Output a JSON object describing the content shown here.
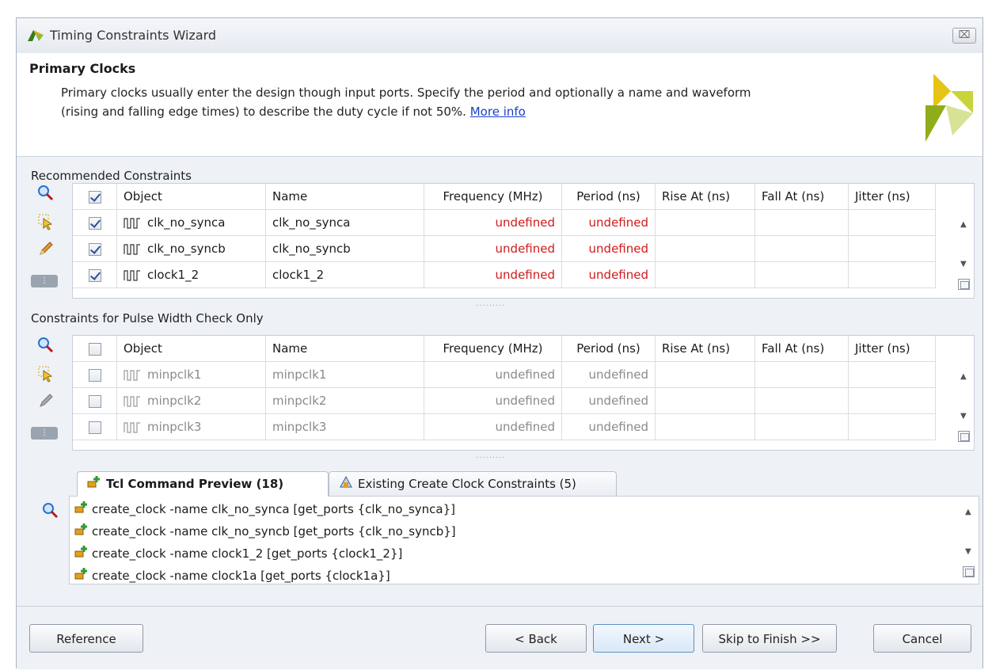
{
  "window": {
    "title": "Timing Constraints Wizard",
    "close_label": "⌧"
  },
  "header": {
    "title": "Primary Clocks",
    "description_line1": "Primary clocks usually enter the design though input ports. Specify the period and optionally a name and waveform",
    "description_line2": "(rising and falling edge times) to describe the duty cycle if not 50%.",
    "more_info": "More info"
  },
  "recommended": {
    "label": "Recommended Constraints",
    "columns": [
      "Object",
      "Name",
      "Frequency (MHz)",
      "Period (ns)",
      "Rise At (ns)",
      "Fall At (ns)",
      "Jitter (ns)"
    ],
    "rows": [
      {
        "object": "clk_no_synca",
        "name": "clk_no_synca",
        "frequency": "undefined",
        "period": "undefined",
        "checked": true
      },
      {
        "object": "clk_no_syncb",
        "name": "clk_no_syncb",
        "frequency": "undefined",
        "period": "undefined",
        "checked": true
      },
      {
        "object": "clock1_2",
        "name": "clock1_2",
        "frequency": "undefined",
        "period": "undefined",
        "checked": true
      }
    ]
  },
  "pulse": {
    "label": "Constraints for Pulse Width Check Only",
    "columns": [
      "Object",
      "Name",
      "Frequency (MHz)",
      "Period (ns)",
      "Rise At (ns)",
      "Fall At (ns)",
      "Jitter (ns)"
    ],
    "rows": [
      {
        "object": "minpclk1",
        "name": "minpclk1",
        "frequency": "undefined",
        "period": "undefined",
        "checked": false
      },
      {
        "object": "minpclk2",
        "name": "minpclk2",
        "frequency": "undefined",
        "period": "undefined",
        "checked": false
      },
      {
        "object": "minpclk3",
        "name": "minpclk3",
        "frequency": "undefined",
        "period": "undefined",
        "checked": false
      }
    ]
  },
  "splitter": "·········",
  "tabs": [
    {
      "label": "Tcl Command Preview (18)",
      "active": true
    },
    {
      "label": "Existing Create Clock Constraints (5)",
      "active": false
    }
  ],
  "tcl": [
    "create_clock -name clk_no_synca [get_ports {clk_no_synca}]",
    "create_clock -name clk_no_syncb [get_ports {clk_no_syncb}]",
    "create_clock -name clock1_2 [get_ports {clock1_2}]",
    "create_clock -name clock1a [get_ports {clock1a}]"
  ],
  "buttons": {
    "reference": "Reference",
    "back": "< Back",
    "next": "Next >",
    "skip": "Skip to Finish >>",
    "cancel": "Cancel"
  },
  "icons": {
    "search": "search-icon",
    "select": "select-cursor-icon",
    "edit": "pencil-icon",
    "tcl": "tcl-add-icon",
    "existing": "clock-constraint-icon"
  },
  "colors": {
    "undefined_red": "#d11a1a",
    "link_blue": "#1a3ec8"
  }
}
